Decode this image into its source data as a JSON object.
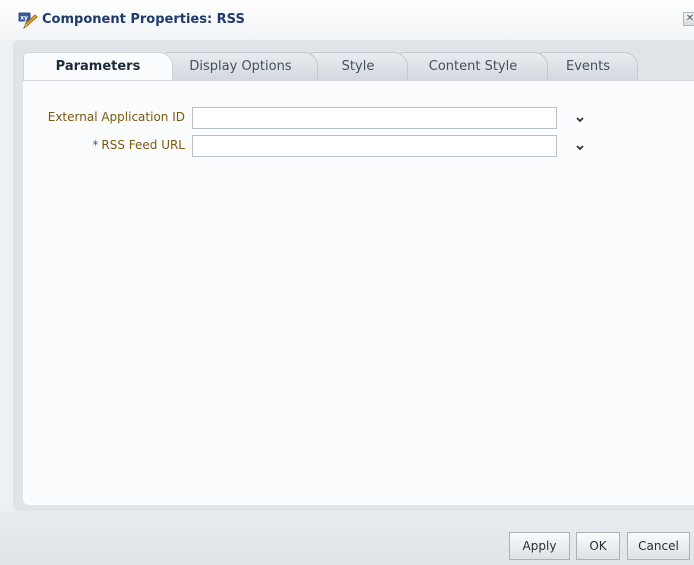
{
  "dialog": {
    "title": "Component Properties: RSS",
    "title_icon": "edit-pencil-xy-icon",
    "close_icon": "close-icon"
  },
  "tabs": [
    {
      "label": "Parameters",
      "active": true
    },
    {
      "label": "Display Options",
      "active": false
    },
    {
      "label": "Style",
      "active": false
    },
    {
      "label": "Content Style",
      "active": false
    },
    {
      "label": "Events",
      "active": false
    }
  ],
  "form": {
    "external_app_id": {
      "label": "External Application ID",
      "value": "",
      "required": false
    },
    "rss_feed_url": {
      "label": "RSS Feed URL",
      "required_marker": "*",
      "value": "",
      "required": true
    }
  },
  "buttons": {
    "apply": "Apply",
    "ok": "OK",
    "cancel": "Cancel"
  },
  "colors": {
    "title_text": "#1e3a6e",
    "field_label": "#7a5a10",
    "required_marker": "#2a5ea8"
  }
}
